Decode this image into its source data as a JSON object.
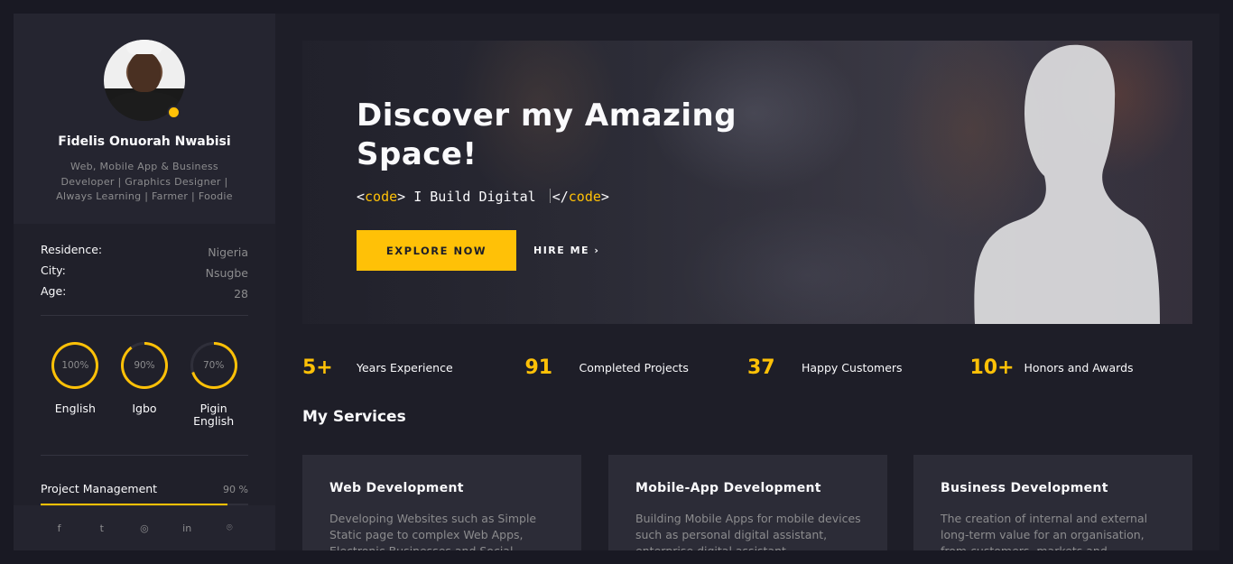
{
  "sidebar": {
    "name": "Fidelis Onuorah Nwabisi",
    "bio": "Web, Mobile App & Business Developer | Graphics Designer | Always Learning | Farmer | Foodie",
    "info": [
      {
        "label": "Residence:",
        "value": "Nigeria"
      },
      {
        "label": "City:",
        "value": "Nsugbe"
      },
      {
        "label": "Age:",
        "value": "28"
      }
    ],
    "languages": [
      {
        "label": "English",
        "percent_text": "100%",
        "percent": 100
      },
      {
        "label": "Igbo",
        "percent_text": "90%",
        "percent": 90
      },
      {
        "label": "Pigin English",
        "percent_text": "70%",
        "percent": 70
      }
    ],
    "skill": {
      "label": "Project Management",
      "percent_text": "90 %",
      "percent": 90
    },
    "socials": [
      "facebook-icon",
      "twitter-icon",
      "instagram-icon",
      "linkedin-icon",
      "github-icon"
    ],
    "socials_glyphs": [
      "f",
      "t",
      "◎",
      "in",
      "⌾"
    ]
  },
  "hero": {
    "title": "Discover my Amazing Space!",
    "typed_open": "<",
    "typed_tag": "code",
    "typed_close": ">",
    "typed_text": " I Build Digital ",
    "typed_end_open": "</",
    "typed_end_tag": "code",
    "typed_end_close": ">",
    "explore_button": "EXPLORE NOW",
    "hire_button": "HIRE ME",
    "hire_chevron": "›"
  },
  "counters": [
    {
      "number": "5+",
      "label": "Years Experience"
    },
    {
      "number": "91",
      "label": "Completed Projects"
    },
    {
      "number": "37",
      "label": "Happy Customers"
    },
    {
      "number": "10+",
      "label": "Honors and Awards"
    }
  ],
  "services": {
    "title": "My Services",
    "items": [
      {
        "title": "Web Development",
        "text": "Developing Websites such as Simple Static page to complex Web Apps, Electronic Businesses and Social"
      },
      {
        "title": "Mobile-App Development",
        "text": "Building Mobile Apps for mobile devices such as personal digital assistant, enterprise digital assistant"
      },
      {
        "title": "Business Development",
        "text": "The creation of internal and external long-term value for an organisation, from customers, markets and"
      }
    ]
  },
  "colors": {
    "accent": "#ffc107",
    "background": "#1e1e28",
    "card": "#2c2c37",
    "muted": "#8c8c8e"
  }
}
